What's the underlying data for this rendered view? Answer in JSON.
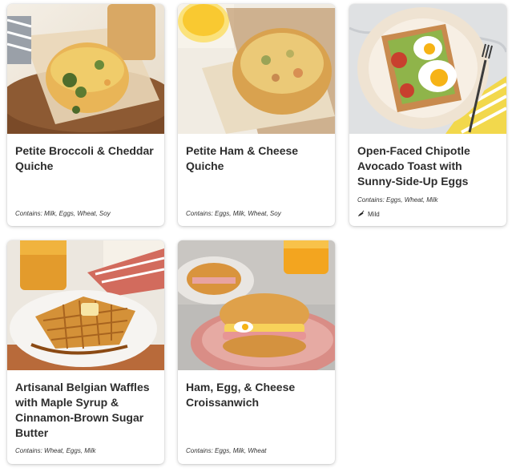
{
  "menu_items": [
    {
      "title": "Petite Broccoli & Cheddar Quiche",
      "allergens": "Contains: Milk, Eggs, Wheat, Soy",
      "image": "broccoli-quiche-photo"
    },
    {
      "title": "Petite Ham & Cheese Quiche",
      "allergens": "Contains: Eggs, Milk, Wheat, Soy",
      "image": "ham-cheese-quiche-photo"
    },
    {
      "title": "Open-Faced Chipotle Avocado Toast with Sunny-Side-Up Eggs",
      "allergens": "Contains: Eggs, Wheat, Milk",
      "spice_level": "Mild",
      "spice_icon": "pepper-icon",
      "image": "avocado-toast-photo"
    },
    {
      "title": "Artisanal Belgian Waffles with Maple Syrup & Cinnamon-Brown Sugar Butter",
      "allergens": "Contains: Wheat, Eggs, Milk",
      "image": "belgian-waffles-photo"
    },
    {
      "title": "Ham, Egg, & Cheese Croissanwich",
      "allergens": "Contains: Eggs, Milk, Wheat",
      "image": "croissanwich-photo"
    }
  ]
}
